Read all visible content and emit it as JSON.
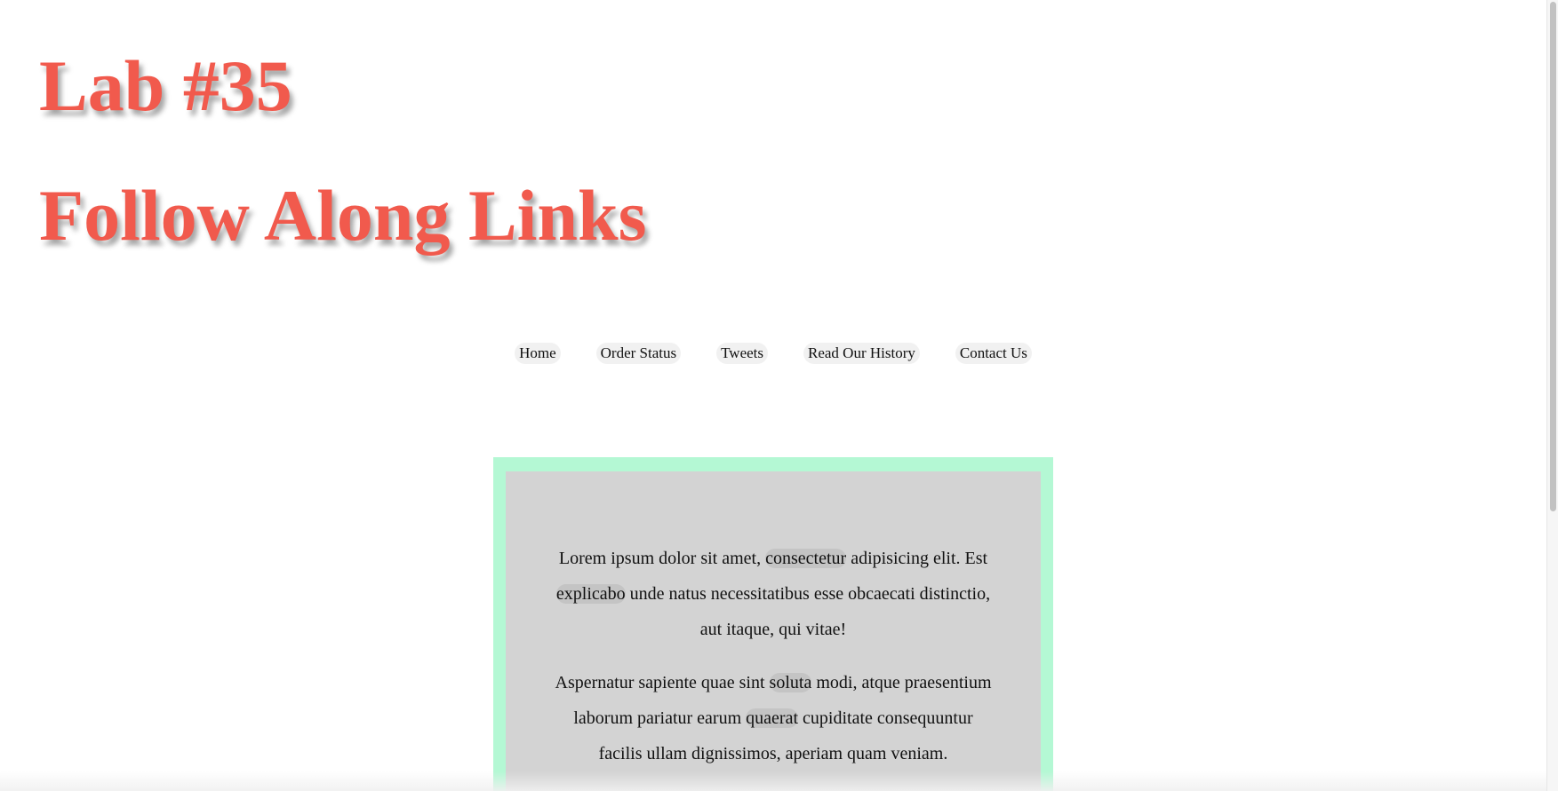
{
  "header": {
    "title_line1": "Lab #35",
    "title_line2": "Follow Along Links"
  },
  "nav": {
    "items": [
      "Home",
      "Order Status",
      "Tweets",
      "Read Our History",
      "Contact Us"
    ]
  },
  "content": {
    "paragraph1": {
      "before_1": "Lorem ipsum dolor sit amet, ",
      "link_1": "consectetur",
      "between_1": " adipisicing elit. Est ",
      "link_2": "explicabo",
      "after_1": " unde natus necessitatibus esse obcaecati distinctio, aut itaque, qui vitae!"
    },
    "paragraph2": {
      "before_1": "Aspernatur sapiente quae sint ",
      "link_1": "soluta",
      "between_1": " modi, atque praesentium laborum pariatur earum ",
      "link_2": "quaerat",
      "after_1": " cupiditate consequuntur facilis ullam dignissimos, aperiam quam veniam."
    }
  },
  "colors": {
    "title": "#f15a4d",
    "card_border": "#b4f8d4",
    "card_background": "#d3d3d3",
    "link_highlight": "#c4c4c4"
  }
}
